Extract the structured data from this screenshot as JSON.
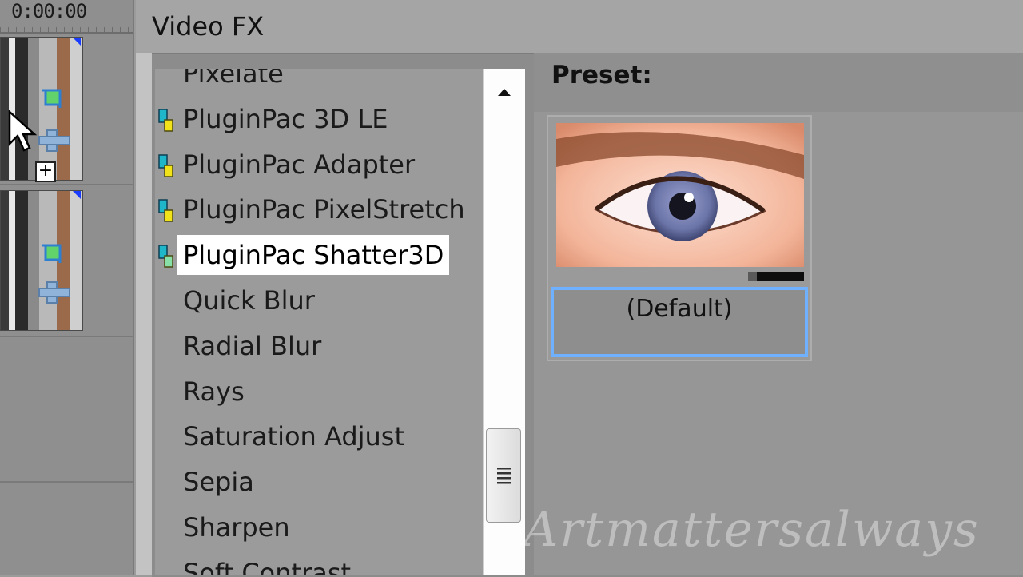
{
  "timeline": {
    "timecode": "0:00:00",
    "clips": [
      {
        "icons": [
          "crop-icon",
          "plugin-chain-icon"
        ]
      },
      {
        "icons": [
          "crop-icon",
          "plugin-chain-icon"
        ]
      }
    ],
    "add_badge": "+"
  },
  "panel": {
    "title": "Video FX",
    "preset_label": "Preset:"
  },
  "fx_list": {
    "items": [
      {
        "label": "Pixelate",
        "icon": null
      },
      {
        "label": "PluginPac 3D LE",
        "icon": "plugin-icon"
      },
      {
        "label": "PluginPac Adapter",
        "icon": "plugin-icon"
      },
      {
        "label": "PluginPac PixelStretch",
        "icon": "plugin-icon"
      },
      {
        "label": "PluginPac Shatter3D",
        "icon": "plugin-icon",
        "selected": true
      },
      {
        "label": "Quick Blur",
        "icon": null
      },
      {
        "label": "Radial Blur",
        "icon": null
      },
      {
        "label": "Rays",
        "icon": null
      },
      {
        "label": "Saturation Adjust",
        "icon": null
      },
      {
        "label": "Sepia",
        "icon": null
      },
      {
        "label": "Sharpen",
        "icon": null
      },
      {
        "label": "Soft Contrast",
        "icon": null
      }
    ]
  },
  "presets": {
    "items": [
      {
        "name": "(Default)",
        "thumbnail": "eye-closeup",
        "progress": 0.15
      }
    ]
  },
  "watermark": "Artmattersalways",
  "colors": {
    "selection_border": "#6fb0ff",
    "plugin_icon_cyan": "#1fb6c9",
    "plugin_icon_yellow": "#f2e21a",
    "clip_marker_blue": "#1a3cff"
  }
}
